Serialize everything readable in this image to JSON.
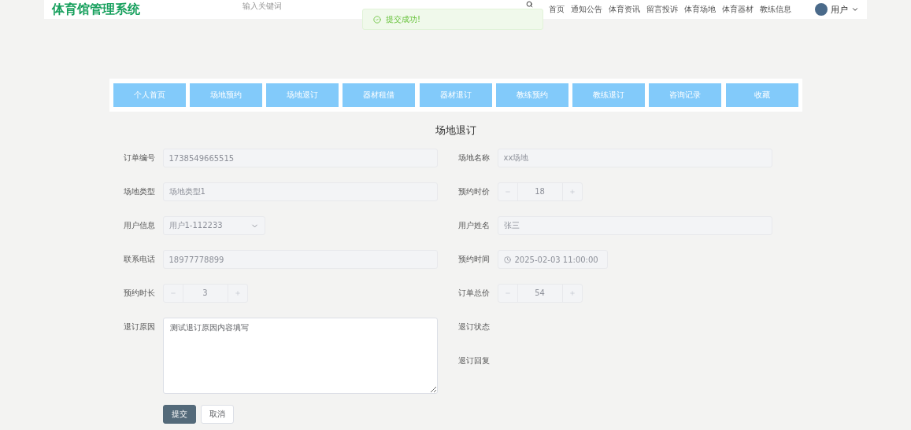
{
  "header": {
    "logo": "体育馆管理系统",
    "search": {
      "placeholder": "输入关键词"
    },
    "nav": [
      "首页",
      "通知公告",
      "体育资讯",
      "留言投诉",
      "体育场地",
      "体育器材",
      "教练信息"
    ],
    "user": {
      "name": "用户"
    }
  },
  "toast": {
    "kind": "success",
    "message": "提交成功!"
  },
  "menu": [
    "个人首页",
    "场地预约",
    "场地退订",
    "器材租借",
    "器材退订",
    "教练预约",
    "教练退订",
    "咨询记录",
    "收藏"
  ],
  "form": {
    "title": "场地退订",
    "left": [
      {
        "label": "订单编号",
        "kind": "text",
        "value": "1738549665515",
        "disabled": true
      },
      {
        "label": "场地类型",
        "kind": "text",
        "value": "场地类型1",
        "disabled": true
      },
      {
        "label": "用户信息",
        "kind": "select",
        "value": "用户1-112233",
        "disabled": true
      },
      {
        "label": "联系电话",
        "kind": "text",
        "value": "18977778899",
        "disabled": true
      },
      {
        "label": "预约时长",
        "kind": "number",
        "value": "3",
        "disabled": true
      },
      {
        "label": "退订原因",
        "kind": "textarea",
        "value": "测试退订原因内容填写",
        "disabled": false
      }
    ],
    "right": [
      {
        "label": "场地名称",
        "kind": "text",
        "value": "xx场地",
        "disabled": true
      },
      {
        "label": "预约时价",
        "kind": "number",
        "value": "18",
        "disabled": true
      },
      {
        "label": "用户姓名",
        "kind": "text",
        "value": "张三",
        "disabled": true
      },
      {
        "label": "预约时间",
        "kind": "date",
        "value": "2025-02-03 11:00:00",
        "disabled": true
      },
      {
        "label": "订单总价",
        "kind": "number",
        "value": "54",
        "disabled": true
      },
      {
        "label": "退订状态",
        "kind": "static"
      },
      {
        "label": "退订回复",
        "kind": "static"
      }
    ],
    "buttons": [
      {
        "label": "提交",
        "kind": "primary"
      },
      {
        "label": "取消",
        "kind": "default"
      }
    ]
  }
}
